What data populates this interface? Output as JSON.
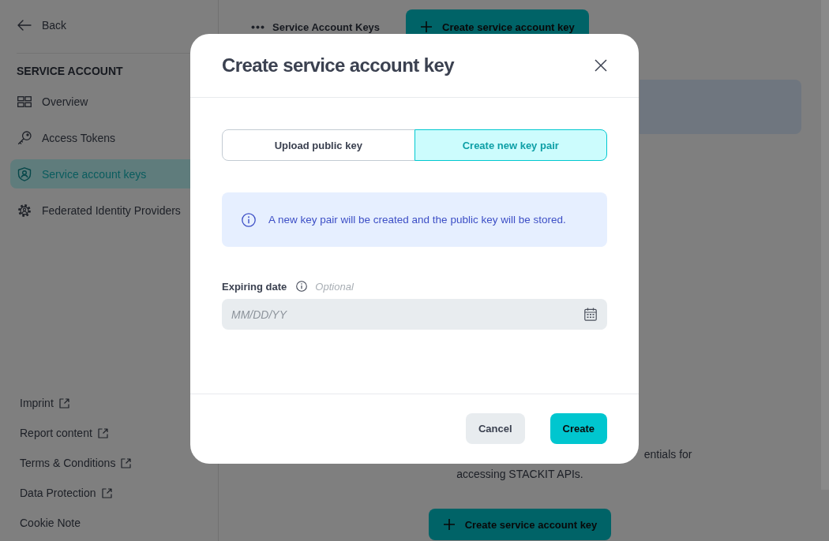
{
  "sidebar": {
    "back": "Back",
    "section_title": "SERVICE ACCOUNT",
    "items": [
      {
        "label": "Overview",
        "selected": false
      },
      {
        "label": "Access Tokens",
        "selected": false
      },
      {
        "label": "Service account keys",
        "selected": true
      },
      {
        "label": "Federated Identity Providers",
        "selected": false
      }
    ],
    "footer_links": [
      {
        "label": "Imprint",
        "external": true
      },
      {
        "label": "Report content",
        "external": true
      },
      {
        "label": "Terms & Conditions",
        "external": true
      },
      {
        "label": "Data Protection",
        "external": true
      },
      {
        "label": "Cookie Note",
        "external": false
      }
    ]
  },
  "main": {
    "header": {
      "title": "Service Account Keys",
      "button": "Create service account key"
    },
    "empty_state": {
      "description_lines": [
        "entials for",
        "accessing STACKIT APIs."
      ],
      "button": "Create service account key"
    }
  },
  "dialog": {
    "title": "Create service account key",
    "tabs": [
      {
        "label": "Upload public key",
        "selected": false
      },
      {
        "label": "Create new key pair",
        "selected": true
      }
    ],
    "notice": "A new key pair will be created and the public key will be stored.",
    "field": {
      "label": "Expiring date",
      "hint": "Optional",
      "placeholder": "MM/DD/YY"
    },
    "buttons": [
      {
        "label": "Cancel",
        "kind": "secondary"
      },
      {
        "label": "Create",
        "kind": "primary"
      }
    ]
  }
}
